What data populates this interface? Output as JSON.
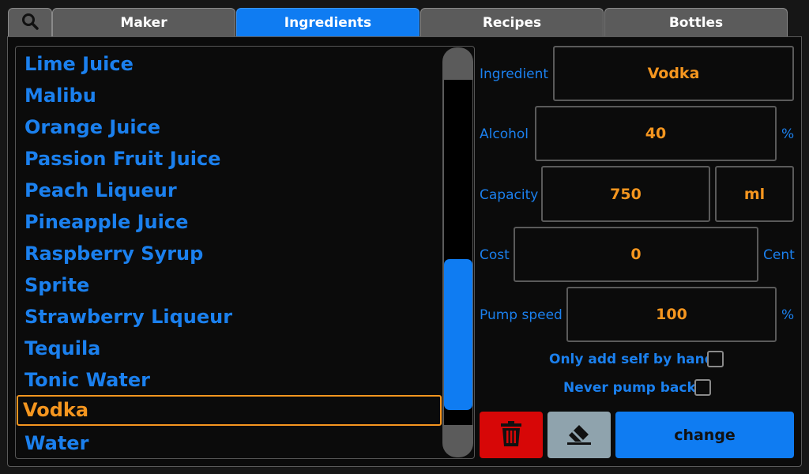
{
  "tabs": {
    "search_icon": "search-icon",
    "items": [
      {
        "label": "Maker"
      },
      {
        "label": "Ingredients"
      },
      {
        "label": "Recipes"
      },
      {
        "label": "Bottles"
      }
    ],
    "active": "Ingredients"
  },
  "ingredients_list": {
    "items": [
      "Lime Juice",
      "Malibu",
      "Orange Juice",
      "Passion Fruit Juice",
      "Peach Liqueur",
      "Pineapple Juice",
      "Raspberry Syrup",
      "Sprite",
      "Strawberry Liqueur",
      "Tequila",
      "Tonic Water",
      "Vodka",
      "Water"
    ],
    "selected": "Vodka",
    "scroll_position": 0.72
  },
  "form": {
    "ingredient": {
      "label": "Ingredient",
      "value": "Vodka"
    },
    "alcohol": {
      "label": "Alcohol",
      "value": "40",
      "unit": "%"
    },
    "capacity": {
      "label": "Capacity",
      "value": "750",
      "unit": "ml"
    },
    "cost": {
      "label": "Cost",
      "value": "0",
      "unit": "Cent"
    },
    "pump_speed": {
      "label": "Pump speed",
      "value": "100",
      "unit": "%"
    },
    "only_add_by_hand": {
      "label": "Only add self by hand",
      "checked": false
    },
    "never_pump_back": {
      "label": "Never pump back",
      "checked": false
    }
  },
  "buttons": {
    "delete_icon": "trash-icon",
    "clear_icon": "eraser-icon",
    "change_label": "change"
  },
  "colors": {
    "accent": "#0f7cf2",
    "text_blue": "#1b80ee",
    "value_orange": "#f5961f",
    "delete_red": "#d70707",
    "clear_gray": "#8fa3ad",
    "background": "#0b0b0b"
  }
}
